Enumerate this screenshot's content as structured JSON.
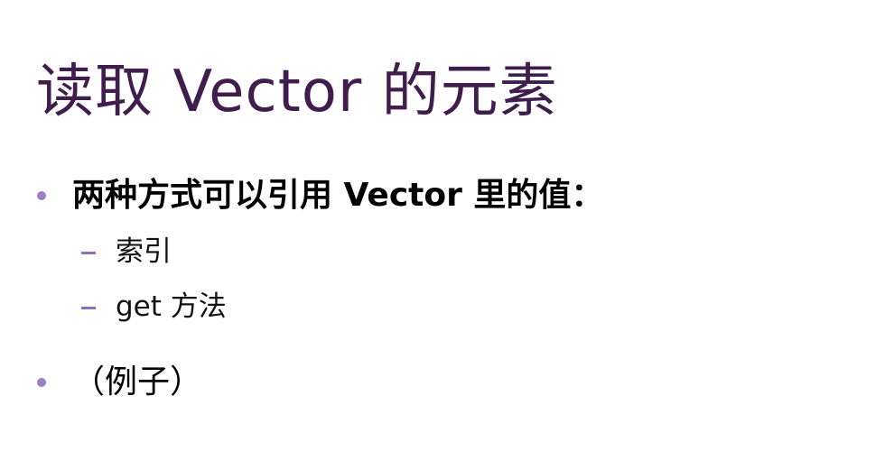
{
  "slide": {
    "title": "读取 Vector 的元素",
    "bullets": [
      {
        "text": "两种方式可以引用 Vector 里的值：",
        "sub_items": [
          "索引",
          "get 方法"
        ]
      },
      {
        "text": "（例子）",
        "sub_items": []
      }
    ]
  },
  "colors": {
    "title": "#3f1d4d",
    "bullet_marker": "#9b7ec8",
    "dash_marker": "#8b6fbf",
    "body_text": "#000000"
  }
}
